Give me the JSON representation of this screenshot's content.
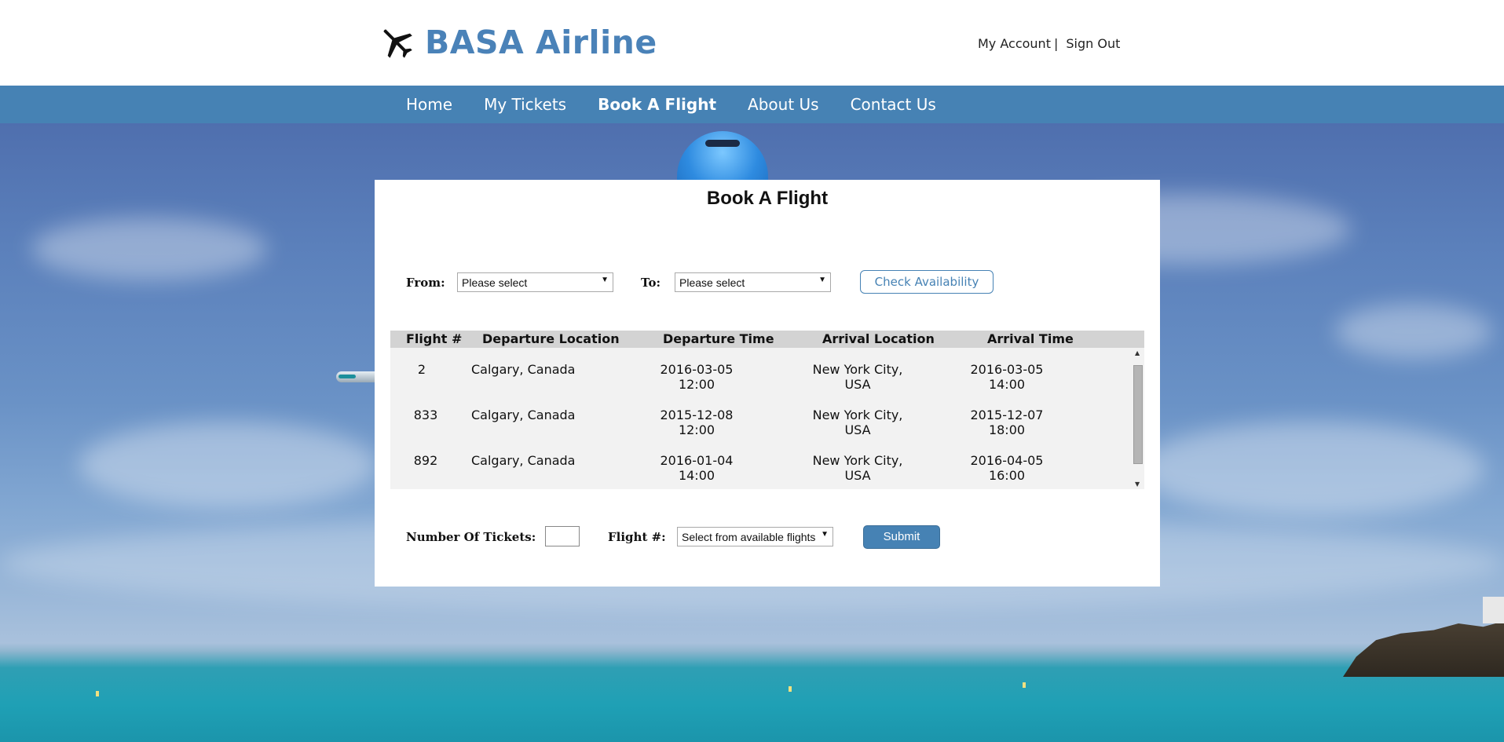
{
  "header": {
    "brand": "BASA Airline",
    "logo_icon": "airplane-icon",
    "my_account": "My Account",
    "separator": "|",
    "sign_out": "Sign Out"
  },
  "nav": {
    "items": [
      {
        "label": "Home"
      },
      {
        "label": "My Tickets"
      },
      {
        "label": "Book A Flight",
        "active": true
      },
      {
        "label": "About Us"
      },
      {
        "label": "Contact Us"
      }
    ]
  },
  "panel": {
    "title": "Book A Flight",
    "from_label": "From:",
    "from_value": "Please select",
    "to_label": "To:",
    "to_value": "Please select",
    "check_button": "Check Availability",
    "table": {
      "headers": [
        "Flight #",
        "Departure Location",
        "Departure Time",
        "Arrival Location",
        "Arrival Time"
      ],
      "rows": [
        {
          "flight": "2",
          "dep_loc": "Calgary, Canada",
          "dep_date": "2016-03-05",
          "dep_time": "12:00",
          "arr_loc1": "New York City,",
          "arr_loc2": "USA",
          "arr_date": "2016-03-05",
          "arr_time": "14:00"
        },
        {
          "flight": "833",
          "dep_loc": "Calgary, Canada",
          "dep_date": "2015-12-08",
          "dep_time": "12:00",
          "arr_loc1": "New York City,",
          "arr_loc2": "USA",
          "arr_date": "2015-12-07",
          "arr_time": "18:00"
        },
        {
          "flight": "892",
          "dep_loc": "Calgary, Canada",
          "dep_date": "2016-01-04",
          "dep_time": "14:00",
          "arr_loc1": "New York City,",
          "arr_loc2": "USA",
          "arr_date": "2016-04-05",
          "arr_time": "16:00"
        }
      ]
    },
    "tickets_label": "Number Of Tickets:",
    "tickets_value": "",
    "flight_label": "Flight #:",
    "flight_select_value": "Select from available flights",
    "submit_button": "Submit"
  },
  "colors": {
    "brand_blue": "#4682b4",
    "header_bg": "#ffffff",
    "table_header_bg": "#d3d3d3",
    "table_body_bg": "#f2f2f2"
  }
}
